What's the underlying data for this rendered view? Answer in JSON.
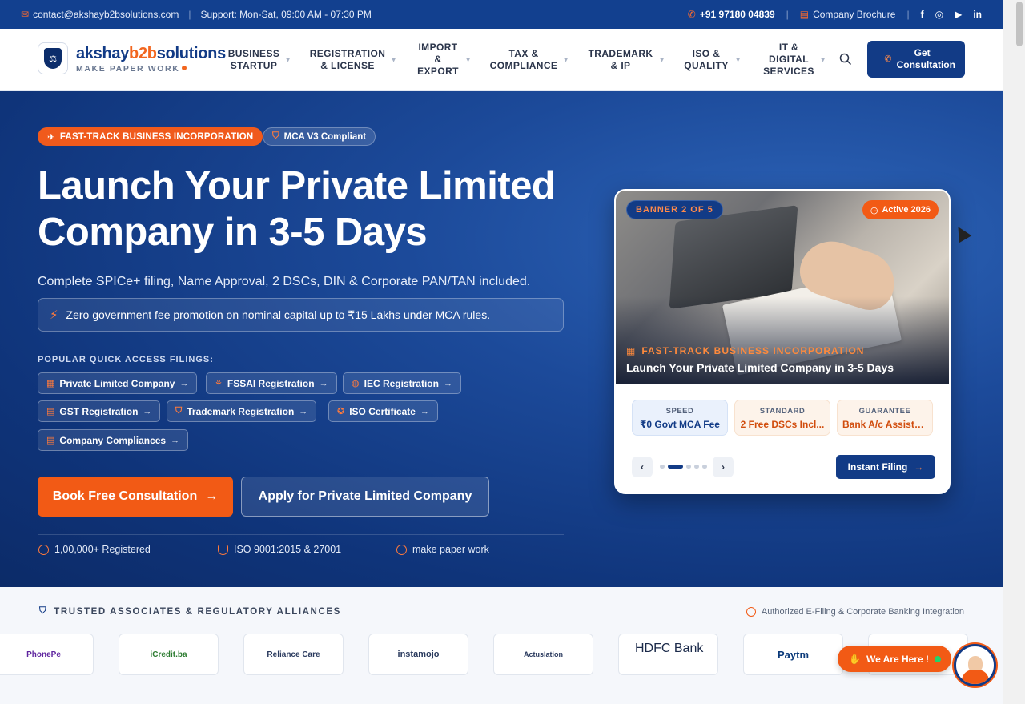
{
  "topbar": {
    "email": "contact@akshayb2bsolutions.com",
    "support": "Support: Mon-Sat, 09:00 AM - 07:30 PM",
    "phone": "+91 97180 04839",
    "brochure": "Company Brochure",
    "social_icons": [
      "facebook-icon",
      "instagram-icon",
      "youtube-icon",
      "linkedin-icon"
    ]
  },
  "header": {
    "brand_prefix": "akshay",
    "brand_mid": "b2b",
    "brand_suffix": "solutions",
    "tagline": "MAKE PAPER WORK",
    "nav": {
      "business": "BUSINESS STARTUP",
      "registration": "REGISTRATION & LICENSE",
      "import": "IMPORT & EXPORT",
      "tax": "TAX & COMPLIANCE",
      "trademark": "TRADEMARK & IP",
      "iso": "ISO & QUALITY",
      "it": "IT & DIGITAL SERVICES"
    },
    "cta": "Get Consultation"
  },
  "hero": {
    "pill_primary": "FAST-TRACK BUSINESS INCORPORATION",
    "pill_secondary": "MCA V3 Compliant",
    "title": "Launch Your Private Limited Company in 3-5 Days",
    "subtitle": "Complete SPICe+ filing, Name Approval, 2 DSCs, DIN & Corporate PAN/TAN included.",
    "promo": "Zero government fee promotion on nominal capital up to ₹15 Lakhs under MCA rules.",
    "quick_title": "POPULAR QUICK ACCESS FILINGS:",
    "chips": {
      "pvt": "Private Limited Company",
      "fssai": "FSSAI Registration",
      "iec": "IEC Registration",
      "gst": "GST Registration",
      "tm": "Trademark Registration",
      "iso": "ISO Certificate",
      "cc": "Company Compliances"
    },
    "btn_primary": "Book Free Consultation",
    "btn_secondary": "Apply for Private Limited Company",
    "stats": {
      "registered": "1,00,000+ Registered",
      "iso": "ISO 9001:2015 & 27001",
      "motto": "make paper work"
    }
  },
  "banner": {
    "badge": "BANNER 2 OF 5",
    "active": "Active 2026",
    "category": "FAST-TRACK BUSINESS INCORPORATION",
    "title": "Launch Your Private Limited Company in 3-5 Days",
    "kpis": {
      "speed_label": "SPEED",
      "speed_value": "₹0 Govt MCA Fee",
      "standard_label": "STANDARD",
      "standard_value": "2 Free DSCs Incl...",
      "guarantee_label": "GUARANTEE",
      "guarantee_value": "Bank A/c Assista..."
    },
    "active_slide": 2,
    "total_slides": 5,
    "instant": "Instant Filing"
  },
  "trusted": {
    "title": "TRUSTED ASSOCIATES & REGULATORY ALLIANCES",
    "right": "Authorized E-Filing & Corporate Banking Integration",
    "logos": {
      "l1": "PhonePe",
      "l2": "iCredit.ba",
      "l3": "Reliance Care",
      "l4": "instamojo",
      "l5": "Actuslation",
      "l6": "HDFC Bank",
      "l7": "Paytm"
    }
  },
  "chat": {
    "label": "We Are Here !"
  },
  "colors": {
    "primary": "#123b86",
    "accent": "#f25a15"
  }
}
